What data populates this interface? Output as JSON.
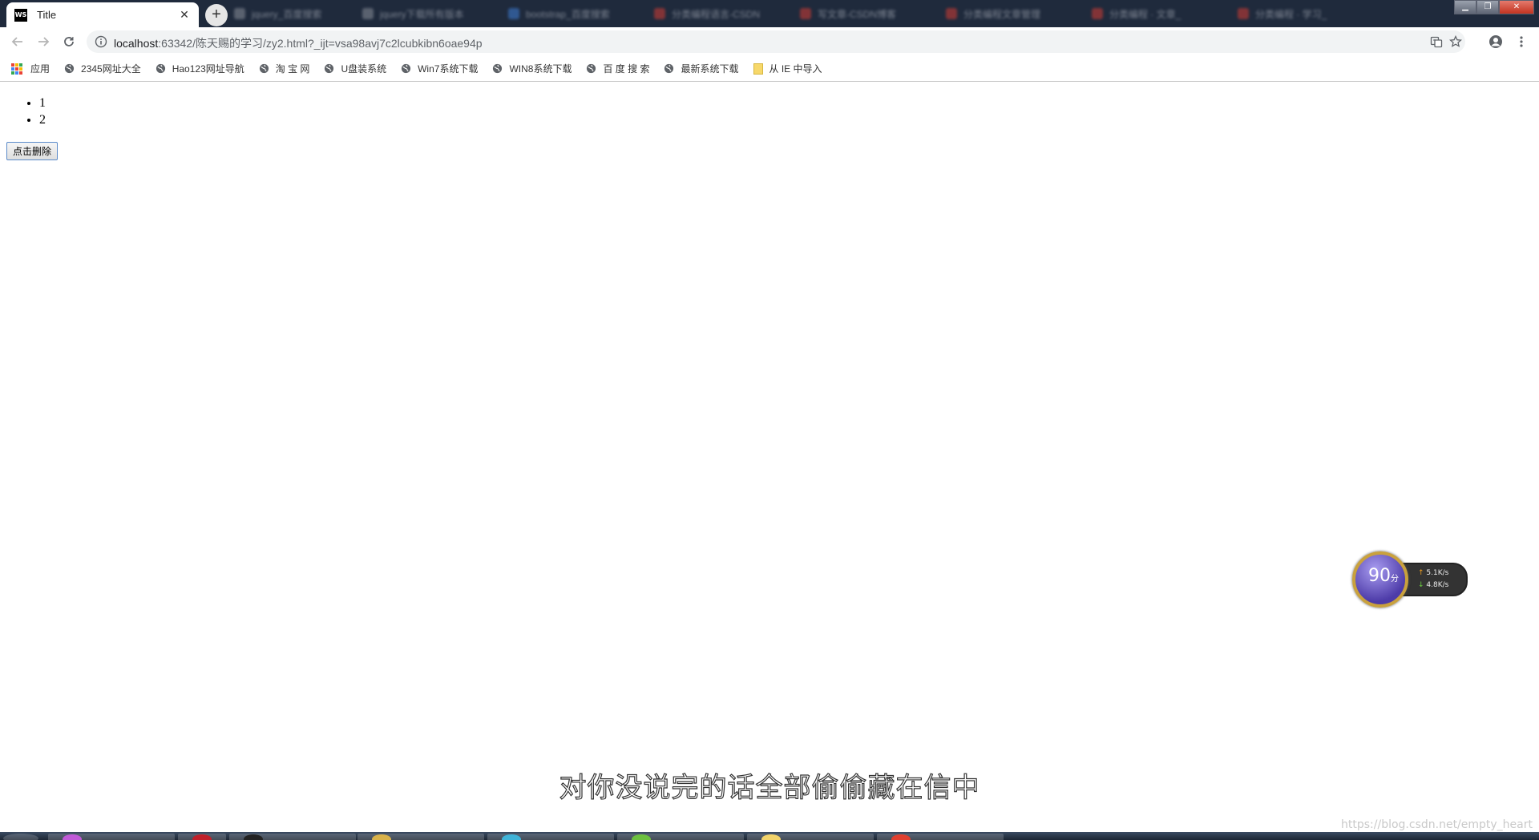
{
  "browser": {
    "active_tab": {
      "title": "Title",
      "favicon_text": "WS"
    },
    "background_tabs": [
      {
        "label": "jquery_百度搜索",
        "icon_color": "#8a8f99"
      },
      {
        "label": "jquery下载所有版本",
        "icon_color": "#8a8f99"
      },
      {
        "label": "bootstrap_百度搜索",
        "icon_color": "#3f7fd8"
      },
      {
        "label": "分类编程语言-CSDN",
        "icon_color": "#d43c33"
      },
      {
        "label": "写文章-CSDN博客",
        "icon_color": "#d43c33"
      },
      {
        "label": "分类编程文章管理",
        "icon_color": "#d43c33"
      },
      {
        "label": "分类编程 · 文章_",
        "icon_color": "#d43c33"
      },
      {
        "label": "分类编程 · 学习_",
        "icon_color": "#d43c33"
      }
    ],
    "url": {
      "host": "localhost",
      "path": ":63342/陈天赐的学习/zy2.html?_ijt=vsa98avj7c2lcubkibn6oae94p"
    }
  },
  "bookmarks": [
    {
      "label": "应用",
      "icon": "apps-grid-icon"
    },
    {
      "label": "2345网址大全",
      "icon": "globe-icon"
    },
    {
      "label": "Hao123网址导航",
      "icon": "globe-icon"
    },
    {
      "label": "淘 宝 网",
      "icon": "globe-icon"
    },
    {
      "label": "U盘装系统",
      "icon": "globe-icon"
    },
    {
      "label": "Win7系统下载",
      "icon": "globe-icon"
    },
    {
      "label": "WIN8系统下载",
      "icon": "globe-icon"
    },
    {
      "label": "百 度 搜 索",
      "icon": "globe-icon"
    },
    {
      "label": "最新系统下载",
      "icon": "globe-icon"
    },
    {
      "label": "从 IE 中导入",
      "icon": "folder-icon"
    }
  ],
  "page": {
    "list_items": [
      "1",
      "2"
    ],
    "delete_button_label": "点击删除"
  },
  "overlay": {
    "speed_score": "90",
    "speed_score_unit": "分",
    "upload_speed": "5.1K/s",
    "download_speed": "4.8K/s",
    "subtitle": "对你没说完的话全部偷偷藏在信中",
    "watermark": "https://blog.csdn.net/empty_heart"
  },
  "colors": {
    "tabstrip": "#1f2a3c",
    "omnibox": "#f1f3f4",
    "button_border": "#5b8bc9",
    "speed_ring": "#c9a13d"
  }
}
